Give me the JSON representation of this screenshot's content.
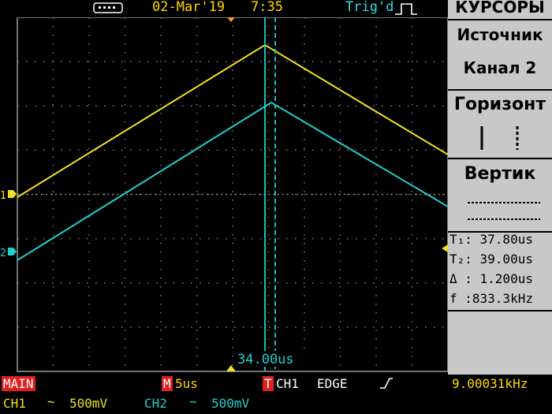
{
  "topbar": {
    "date": "02-Mar'19",
    "time": "7:35",
    "trigger_status": "Trig'd",
    "usb_icon": "usb-icon",
    "trigger_icon": "rising-edge-icon"
  },
  "screen": {
    "channel1_marker": "1",
    "channel2_marker": "2",
    "cursor_readout": "34.00us",
    "colors": {
      "ch1": "#f0e020",
      "ch2": "#20d0d0",
      "grid": "#808080"
    }
  },
  "panel": {
    "title": "КУРСОРЫ",
    "source_label": "Источник",
    "source_value": "Канал 2",
    "horizontal_label": "Горизонт",
    "vertical_label": "Вертик",
    "t1": "T₁: 37.80us",
    "t2": "T₂: 39.00us",
    "delta": "Δ : 1.200us",
    "freq": "f :833.3kHz"
  },
  "bottom": {
    "mode": "MAIN",
    "timebase_tag": "M",
    "timebase": "5us",
    "trigger_tag": "T",
    "trigger_source": "CH1",
    "trigger_type": "EDGE",
    "trigger_freq": "9.00031kHz",
    "ch1_label": "CH1",
    "ch1_coupling": "~",
    "ch1_scale": "500mV",
    "ch2_label": "CH2",
    "ch2_coupling": "~",
    "ch2_scale": "500mV"
  }
}
